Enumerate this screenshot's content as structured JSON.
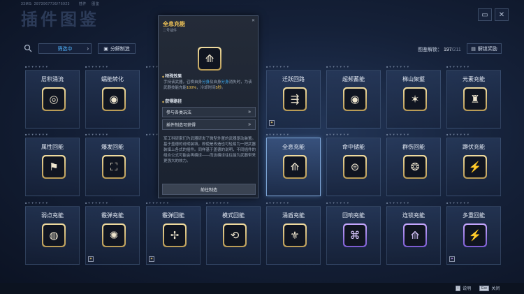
{
  "header": {
    "uid": "33MS: 2873967736/76923　　 插件　 图鉴",
    "title": "插件图鉴",
    "icon_a": "▭",
    "icon_b": "✕"
  },
  "toolbar": {
    "search_icon": "search-icon",
    "filter_label": "筛选中",
    "filter_chevron": "›",
    "decompose_label": "分解制造",
    "unlock_label": "图鉴解锁：",
    "unlock_count": "197",
    "unlock_total": "/211",
    "reward_label": "解锁奖励"
  },
  "row_tag": "■ ▼ ▼ ▼ ▼ ▼ ▼",
  "cards": [
    {
      "name": "层积涌流",
      "glyph": "◎",
      "tier": "gold",
      "mini": ""
    },
    {
      "name": "蠕能转化",
      "glyph": "◉",
      "tier": "gold",
      "mini": ""
    },
    {
      "name": "迁跃回路",
      "glyph": "⇶",
      "tier": "gold",
      "mini": "✦"
    },
    {
      "name": "超频蓄能",
      "glyph": "◉",
      "tier": "gold",
      "mini": ""
    },
    {
      "name": "梯山架壑",
      "glyph": "✶",
      "tier": "gold",
      "mini": ""
    },
    {
      "name": "元素充能",
      "glyph": "♜",
      "tier": "gold",
      "mini": ""
    },
    {
      "name": "属性回能",
      "glyph": "⚑",
      "tier": "gold",
      "mini": ""
    },
    {
      "name": "爆发回能",
      "glyph": "⛶",
      "tier": "gold",
      "mini": ""
    },
    {
      "name": "全息充能",
      "glyph": "⟰",
      "tier": "gold",
      "mini": ""
    },
    {
      "name": "命中储能",
      "glyph": "⊜",
      "tier": "gold",
      "mini": ""
    },
    {
      "name": "群伤回能",
      "glyph": "❂",
      "tier": "gold",
      "mini": ""
    },
    {
      "name": "蹲伏充能",
      "glyph": "⚡",
      "tier": "gold",
      "mini": ""
    },
    {
      "name": "弱点充能",
      "glyph": "◍",
      "tier": "gold",
      "mini": ""
    },
    {
      "name": "霰弹充能",
      "glyph": "✺",
      "tier": "gold",
      "mini": "✦"
    },
    {
      "name": "霰弹回能",
      "glyph": "✢",
      "tier": "gold",
      "mini": "✦"
    },
    {
      "name": "模式回能",
      "glyph": "⟲",
      "tier": "gold",
      "mini": ""
    },
    {
      "name": "涌盾充能",
      "glyph": "⚜",
      "tier": "gold",
      "mini": ""
    },
    {
      "name": "回响充能",
      "glyph": "⌘",
      "tier": "purple",
      "mini": ""
    },
    {
      "name": "连锁充能",
      "glyph": "⟰",
      "tier": "purple",
      "mini": ""
    },
    {
      "name": "多重回能",
      "glyph": "⚡",
      "tier": "purple",
      "mini": "✦"
    }
  ],
  "panel": {
    "title": "全息充能",
    "subtitle": "二号插件",
    "close": "✕",
    "glyph": "⟰",
    "section1": "特殊效果",
    "desc1_a": "手持该武器，召唤自身",
    "desc1_b": "分身",
    "desc1_c": "及自身",
    "desc1_d": "分身",
    "desc1_e": "消失时，为该武器技能充能",
    "desc1_f": "100%",
    "desc1_g": "，冷却时间",
    "desc1_h": "5秒",
    "desc1_i": "。",
    "section2": "获得路径",
    "route1": "参与各类玩法",
    "route2": "插件制造可获得",
    "route_arrow": "»",
    "lore": "军工科研家们为武器研发了微型外置的武器驱动装置。基于盖德的说明装填，即使是改造也可轻易为一把武器装填上各式的插件。同样基于盖德的说明，不同插件的组合公式可能会再编译——而这编译往往能为武器带来更强大的效力。",
    "go_button": "前往制造"
  },
  "footer": {
    "help_key": "i",
    "help_label": "说明",
    "close_key": "Esc",
    "close_label": "关闭"
  }
}
